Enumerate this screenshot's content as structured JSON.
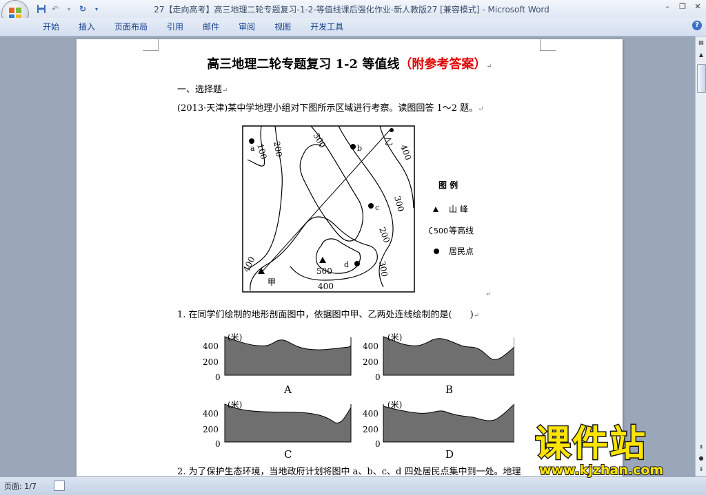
{
  "window": {
    "title": "27【走向高考】高三地理二轮专题复习-1-2-等值线课后强化作业-新人教版27 [兼容模式]",
    "app_name": " - Microsoft Word"
  },
  "ribbon": {
    "tabs": [
      "开始",
      "插入",
      "页面布局",
      "引用",
      "邮件",
      "审阅",
      "视图",
      "开发工具"
    ]
  },
  "document": {
    "title_main": "高三地理二轮专题复习 1-2 等值线",
    "title_red": "（附参考答案）",
    "section": "一、选择题",
    "intro": "(2013·天津)某中学地理小组对下图所示区域进行考察。读图回答 1～2 题。",
    "q1": "1. 在同学们绘制的地形剖面图中，依据图中甲、乙两处连线绘制的是(　　)",
    "q2": "2. 为了保护生态环境，当地政府计划将图中 a、b、c、d 四处居民点集中到一处。地理"
  },
  "map": {
    "contour_labels": [
      "100",
      "200",
      "300",
      "400",
      "300",
      "200",
      "300",
      "400",
      "400",
      "500"
    ],
    "points": {
      "a": "a",
      "b": "b",
      "c": "c",
      "d": "d",
      "jia": "甲",
      "yi": "乙"
    },
    "legend": {
      "title": "图 例",
      "peak": "山 峰",
      "contour_value": "500",
      "contour": "等高线",
      "settlement": "居民点"
    }
  },
  "profiles": {
    "unit": "(米)",
    "ticks": [
      "400",
      "200",
      "0"
    ],
    "labels": [
      "A",
      "B",
      "C",
      "D"
    ]
  },
  "statusbar": {
    "page": "页面: 1/7"
  },
  "watermark": {
    "logo": "课件站",
    "url": "www.kjzhan.com"
  }
}
